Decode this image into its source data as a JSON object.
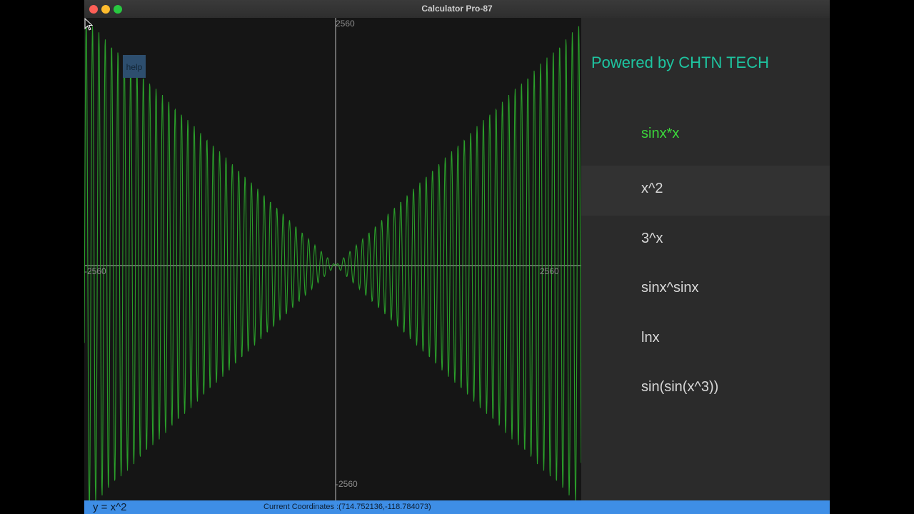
{
  "window": {
    "title": "Calculator Pro-87"
  },
  "graph": {
    "axis_labels": {
      "top": "2560",
      "bottom": "-2560",
      "left": "-2560",
      "right": "2560"
    },
    "help_label": "help",
    "curve_color": "#2a9e2a",
    "axis_color": "#bdbdbd"
  },
  "sidebar": {
    "powered_by": "Powered by CHTN TECH",
    "functions": [
      {
        "label": "sinx*x",
        "state": "selected"
      },
      {
        "label": "x^2",
        "state": "hover"
      },
      {
        "label": "3^x",
        "state": "normal"
      },
      {
        "label": "sinx^sinx",
        "state": "normal"
      },
      {
        "label": "lnx",
        "state": "normal"
      },
      {
        "label": "sin(sin(x^3))",
        "state": "normal"
      }
    ]
  },
  "status": {
    "equation": "y = x^2",
    "coordinates": "Current Coordinates :(714.752136,-118.784073)"
  }
}
